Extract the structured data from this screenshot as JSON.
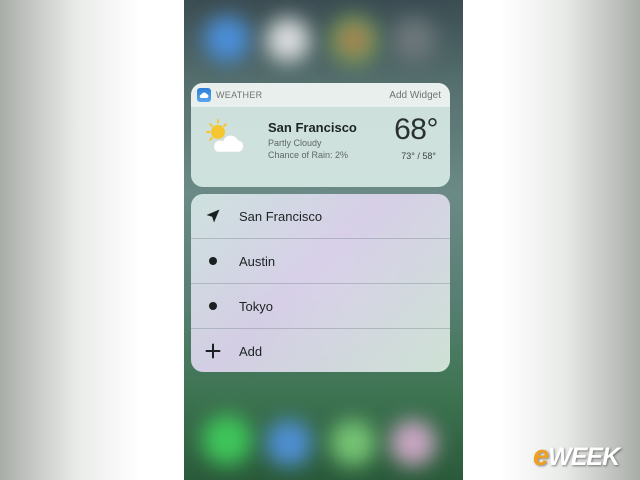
{
  "widget": {
    "app_name": "WEATHER",
    "add_widget": "Add Widget",
    "city": "San Francisco",
    "condition": "Partly Cloudy",
    "rain": "Chance of Rain: 2%",
    "temperature": "68°",
    "range": "73° / 58°",
    "icons": {
      "app": "weather-app-icon",
      "condition": "partly-cloudy-icon"
    }
  },
  "locations": [
    {
      "label": "San Francisco",
      "icon": "location-arrow-icon"
    },
    {
      "label": "Austin",
      "icon": "dot-icon"
    },
    {
      "label": "Tokyo",
      "icon": "dot-icon"
    },
    {
      "label": "Add",
      "icon": "plus-icon"
    }
  ],
  "watermark": {
    "prefix": "e",
    "suffix": "WEEK"
  },
  "colors": {
    "accent": "#2f7fd9",
    "sun": "#f5c630",
    "watermark_accent": "#f0a020"
  }
}
